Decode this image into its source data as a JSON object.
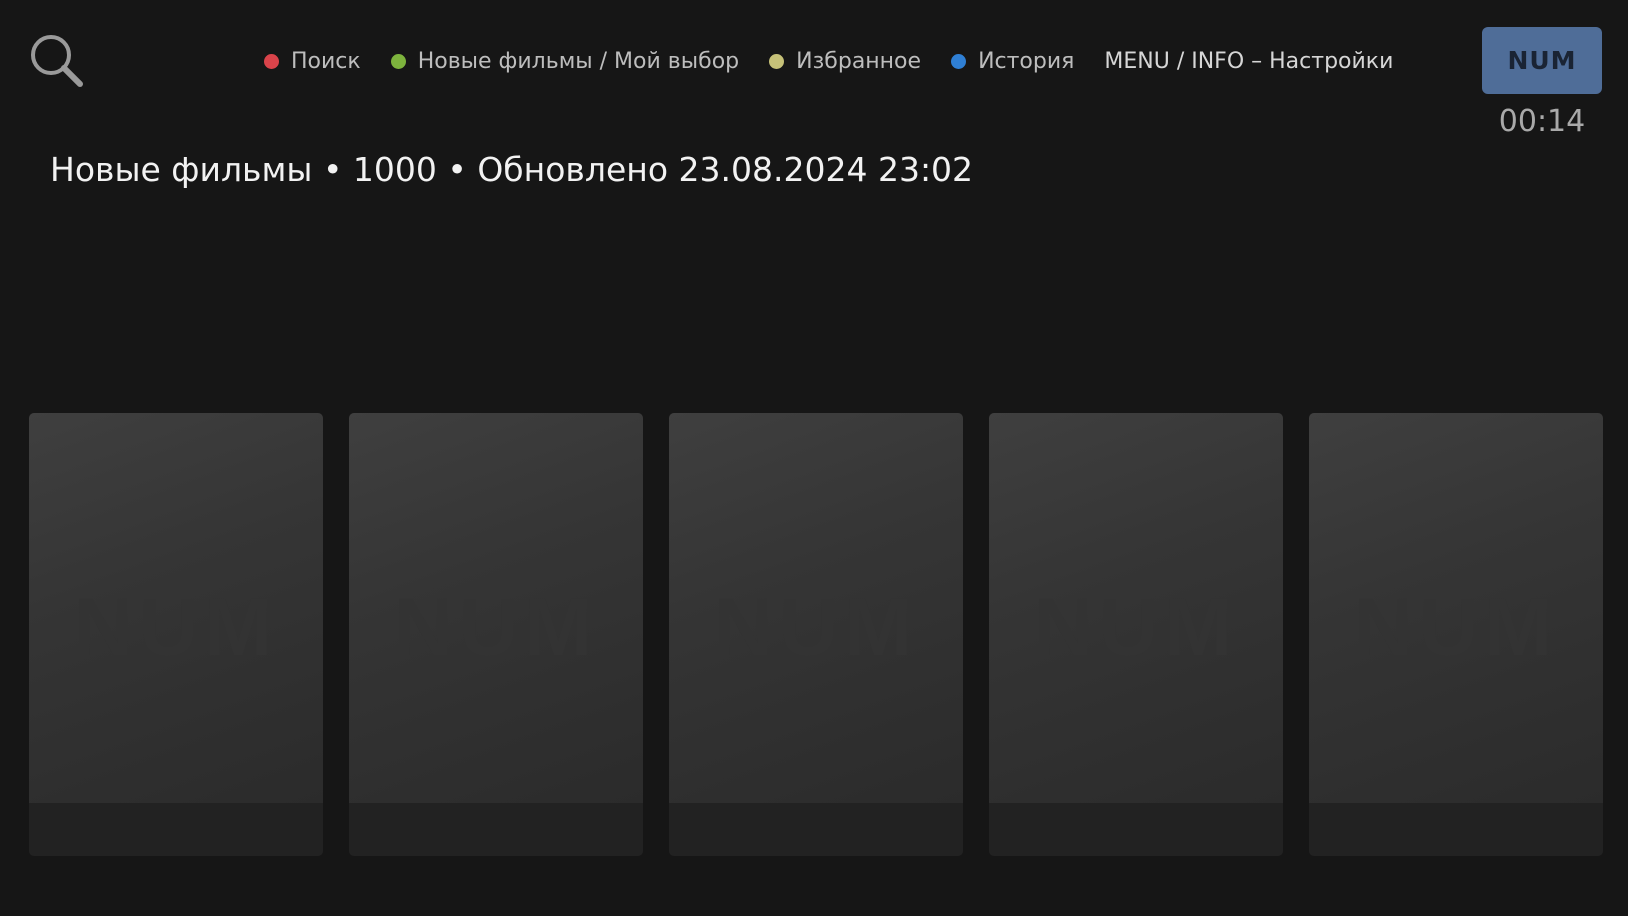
{
  "header": {
    "search_icon": "search-icon",
    "hints": [
      {
        "label": "Поиск",
        "color": "#d9434a"
      },
      {
        "label": "Новые фильмы / Мой выбор",
        "color": "#7db33d"
      },
      {
        "label": "Избранное",
        "color": "#c6c178"
      },
      {
        "label": "История",
        "color": "#2f7fd4"
      }
    ],
    "menu_hint": "MENU / INFO – Настройки",
    "num_button": "NUM",
    "clock": "00:14"
  },
  "section": {
    "title": "Новые фильмы • 1000 • Обновлено 23.08.2024 23:02"
  },
  "posters": [
    {
      "placeholder_logo": "NUM"
    },
    {
      "placeholder_logo": "NUM"
    },
    {
      "placeholder_logo": "NUM"
    },
    {
      "placeholder_logo": "NUM"
    },
    {
      "placeholder_logo": "NUM"
    }
  ],
  "colors": {
    "background": "#161616",
    "num_button": "#4f6d98"
  }
}
